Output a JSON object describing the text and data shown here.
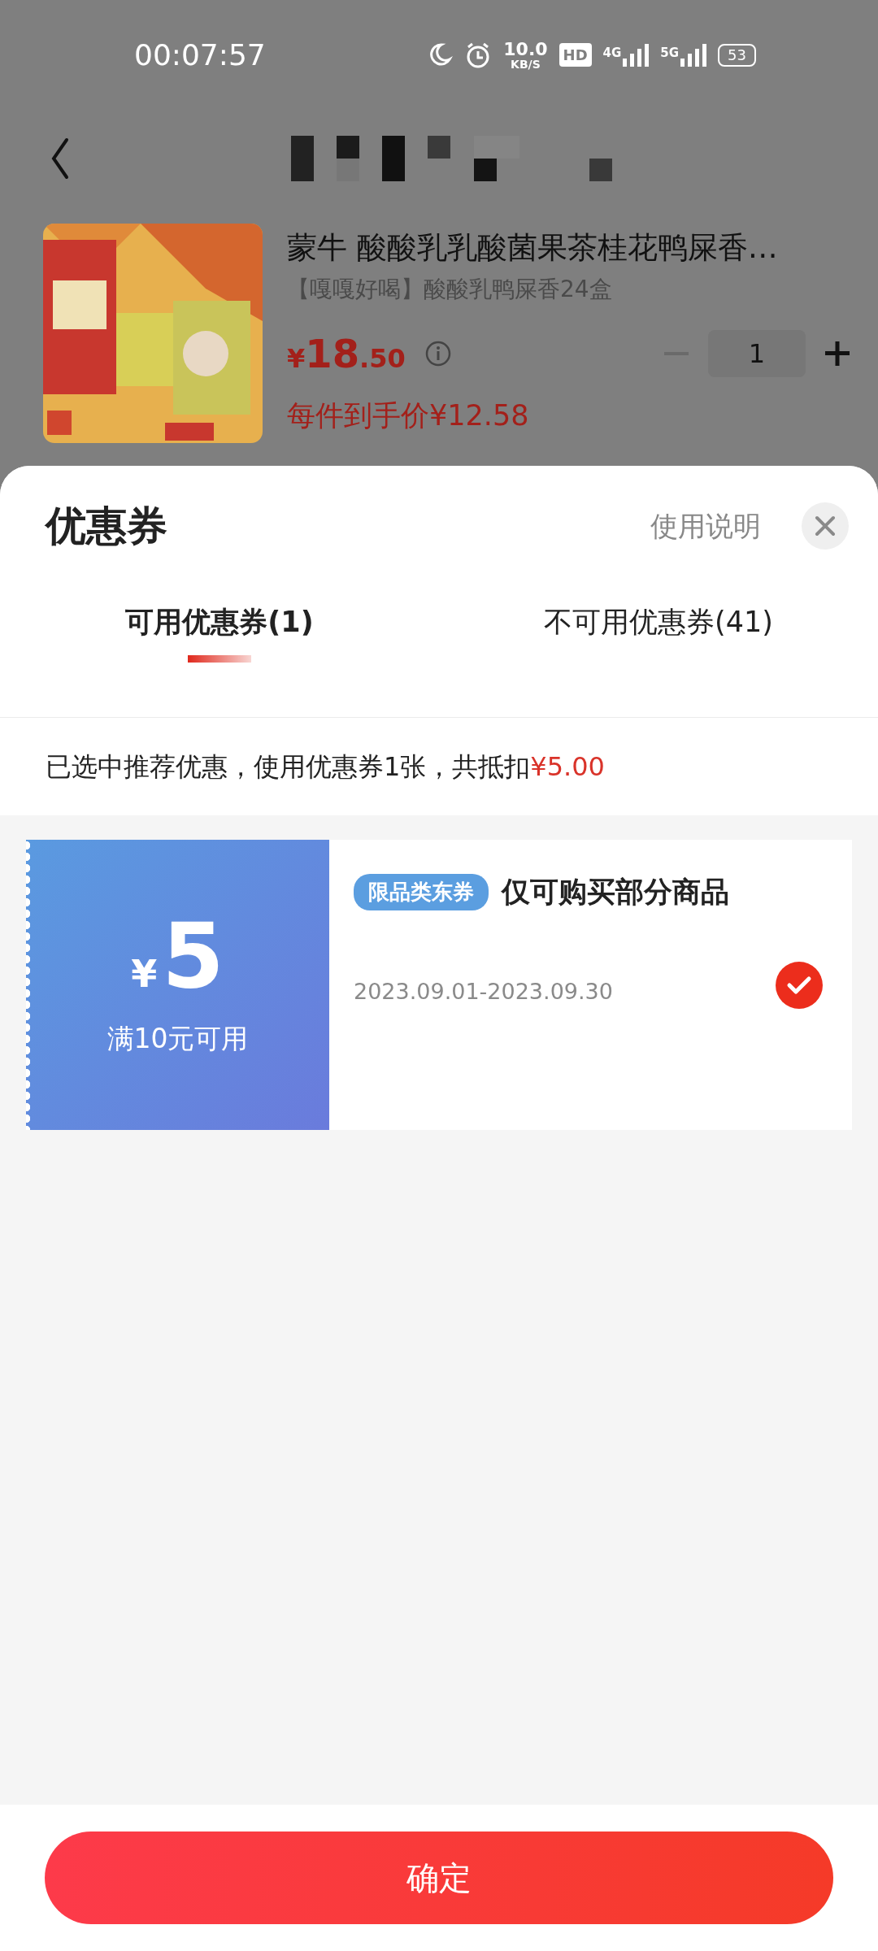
{
  "status_bar": {
    "time": "00:07:57",
    "speed": "10.0",
    "speed_unit": "KB/S",
    "hd": "HD",
    "signal_1": "4G",
    "signal_2": "5G",
    "battery": "53"
  },
  "product": {
    "title": "蒙牛 酸酸乳乳酸菌果茶桂花鸭屎香…",
    "subtitle": "【嘎嘎好喝】酸酸乳鸭屎香24盒",
    "currency": "¥",
    "price_int": "18",
    "price_dec": ".50",
    "quantity": "1",
    "final_price": "每件到手价¥12.58"
  },
  "sheet": {
    "title": "优惠券",
    "help": "使用说明"
  },
  "tabs": [
    {
      "label": "可用优惠券(1)",
      "selected": true
    },
    {
      "label": "不可用优惠券(41)",
      "selected": false
    }
  ],
  "summary": {
    "text": "已选中推荐优惠，使用优惠券1张，共抵扣",
    "amount": "¥5.00"
  },
  "coupons": [
    {
      "currency": "¥",
      "amount": "5",
      "condition": "满10元可用",
      "tag": "限品类东券",
      "title": "仅可购买部分商品",
      "validity": "2023.09.01-2023.09.30",
      "selected": true
    }
  ],
  "confirm_button": "确定"
}
